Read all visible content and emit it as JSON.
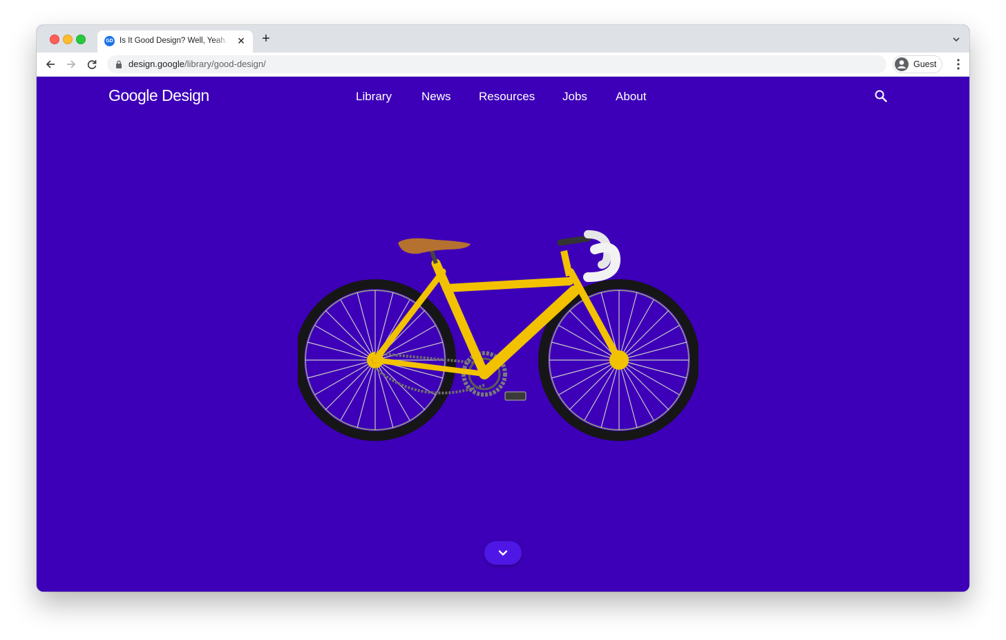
{
  "browser": {
    "tab_title": "Is It Good Design? Well, Yeah.",
    "favicon_text": "GD",
    "url_host": "design.google",
    "url_path": "/library/good-design/",
    "profile_label": "Guest"
  },
  "site": {
    "logo": "Google Design",
    "nav": [
      {
        "label": "Library"
      },
      {
        "label": "News"
      },
      {
        "label": "Resources"
      },
      {
        "label": "Jobs"
      },
      {
        "label": "About"
      }
    ],
    "search_icon": "search-icon",
    "scroll_icon": "chevron-down-icon"
  },
  "colors": {
    "page_background": "#3d00b8",
    "scroll_button": "#4f17e6",
    "bike_frame": "#f2c200",
    "saddle": "#b5712f"
  },
  "hero": {
    "illustration": "yellow-bicycle"
  }
}
